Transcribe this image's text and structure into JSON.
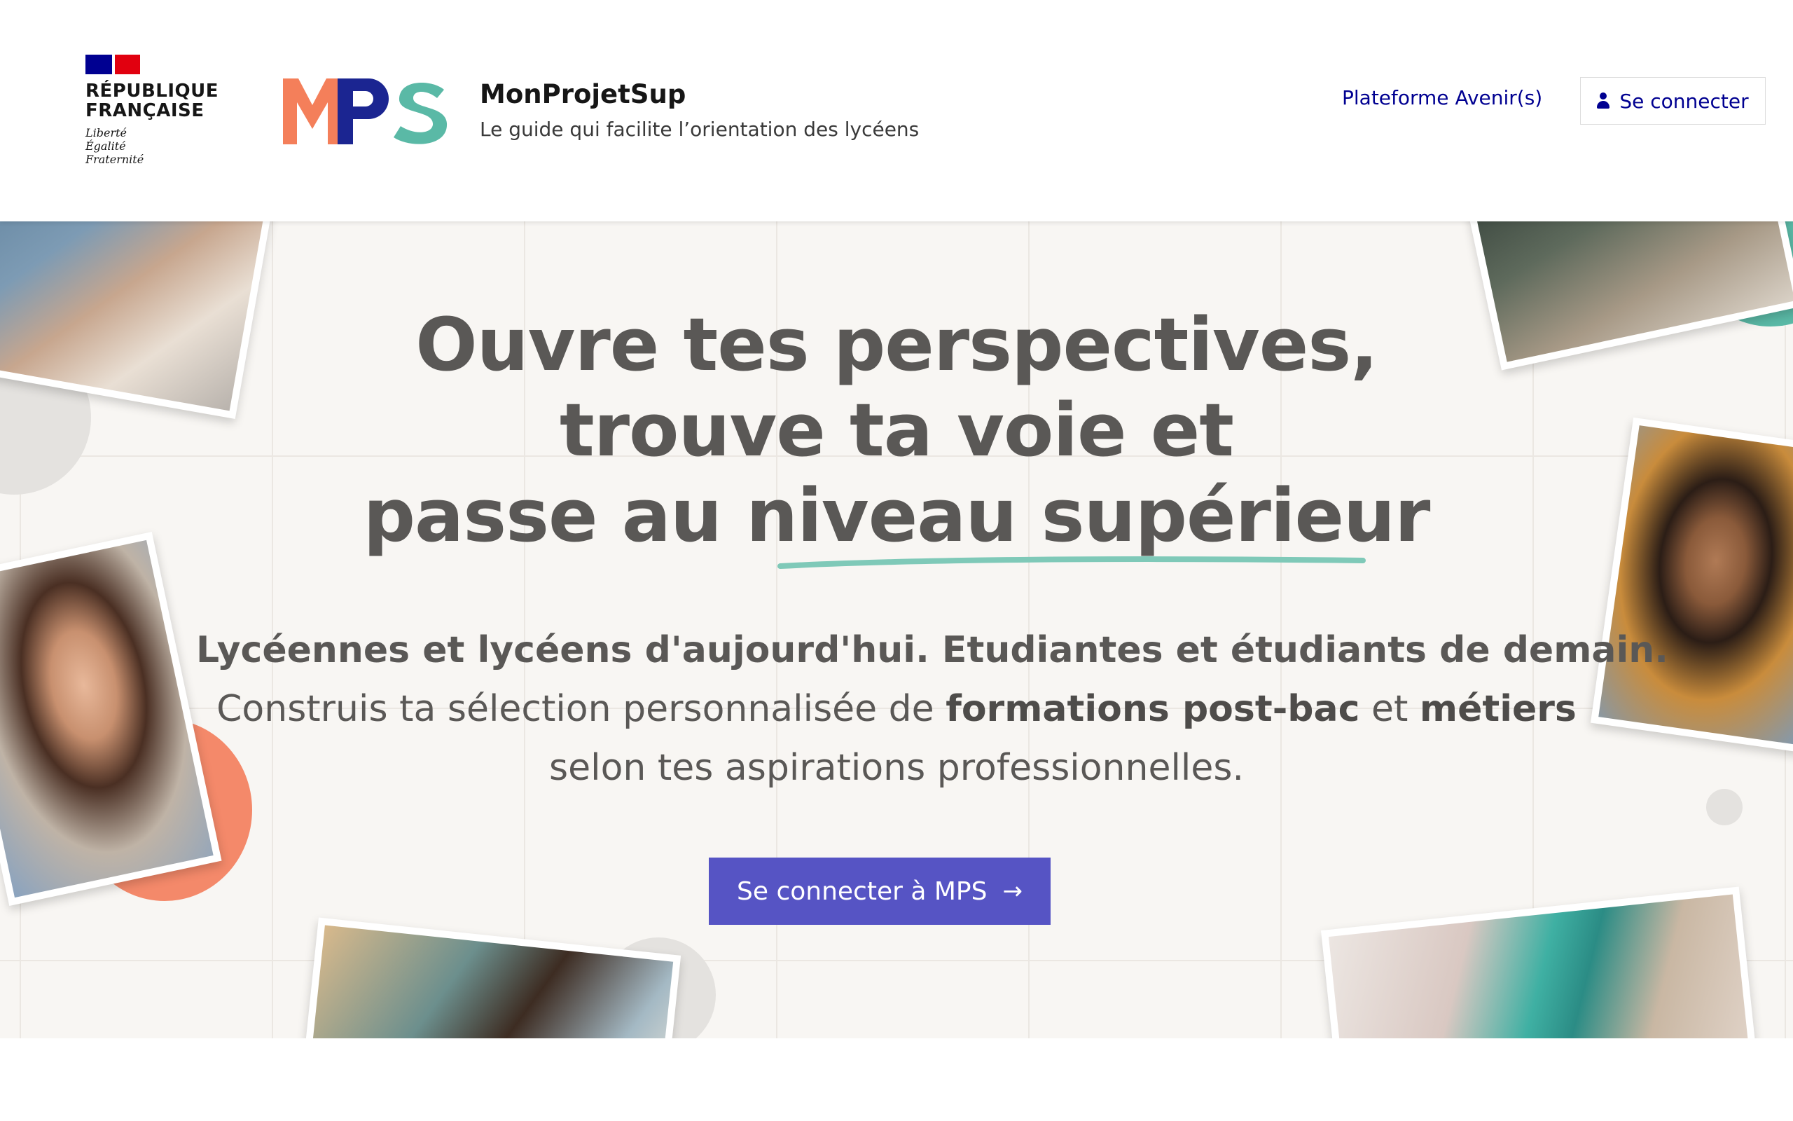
{
  "header": {
    "gov_logo": {
      "title_line1": "RÉPUBLIQUE",
      "title_line2": "FRANÇAISE",
      "motto_line1": "Liberté",
      "motto_line2": "Égalité",
      "motto_line3": "Fraternité"
    },
    "site_logo_text": "MPS",
    "site_name": "MonProjetSup",
    "site_tagline": "Le guide qui facilite l’orientation des lycéens",
    "nav_link": "Plateforme Avenir(s)",
    "login_button": "Se connecter",
    "login_icon": "user-icon"
  },
  "hero": {
    "title_line1": "Ouvre tes perspectives,",
    "title_line2": "trouve ta voie et",
    "title_line3": "passe au niveau supérieur",
    "lead_line1": "Lycéennes et lycéens d'aujourd'hui. Etudiantes et étudiants de demain.",
    "lead_line2_a": "Construis ta sélection personnalisée de ",
    "lead_line2_b": "formations post-bac",
    "lead_line2_c": " et ",
    "lead_line2_d": "métiers",
    "lead_line3": "selon tes aspirations professionnelles.",
    "cta_label": "Se connecter à MPS",
    "cta_icon": "arrow-right-icon"
  },
  "colors": {
    "brand_blue": "#000091",
    "cta_purple": "#5654c4",
    "mps_orange": "#f47f5a",
    "mps_navy": "#1b2591",
    "mps_teal": "#5ab9a6",
    "hero_bg": "#f8f6f3"
  }
}
